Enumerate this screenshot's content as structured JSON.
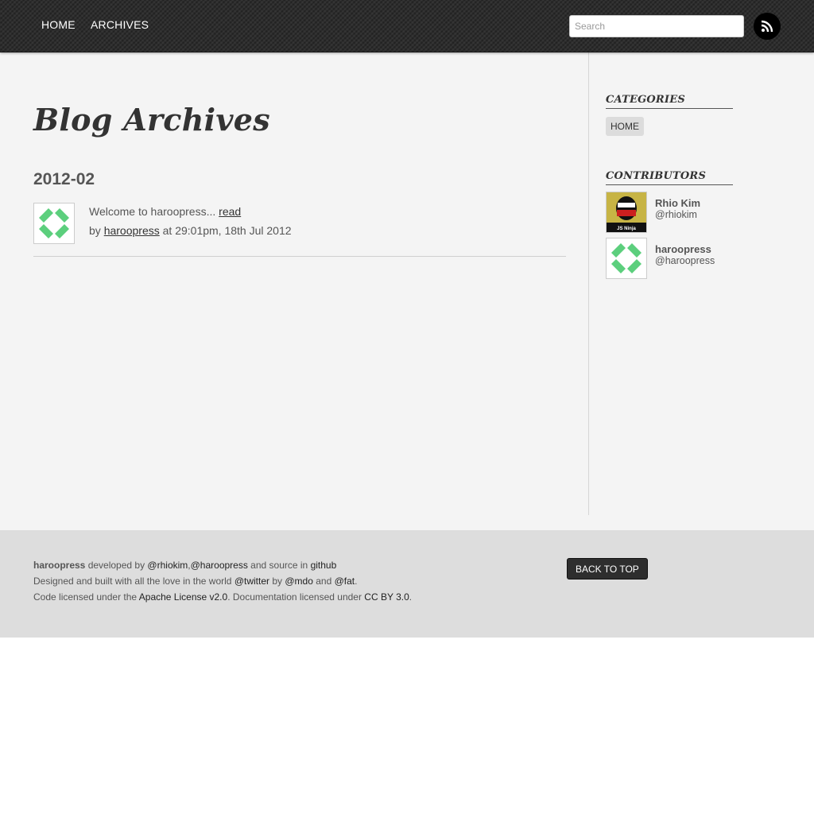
{
  "nav": {
    "home": "HOME",
    "archives": "ARCHIVES",
    "search_placeholder": "Search",
    "rss_icon": "rss-icon"
  },
  "main": {
    "title": "Blog Archives",
    "year": "2012-02",
    "post": {
      "excerpt": "Welcome to haroopress... ",
      "read_label": "read",
      "by_label": "by ",
      "author": "haroopress",
      "date": " at 29:01pm, 18th Jul 2012"
    }
  },
  "sidebar": {
    "categories_heading": "CATEGORIES",
    "categories": [
      "HOME"
    ],
    "contributors_heading": "CONTRIBUTORS",
    "contributors": [
      {
        "name": "Rhio Kim",
        "handle": "@rhiokim",
        "avatar_text": "JS Ninja"
      },
      {
        "name": "haroopress",
        "handle": "@haroopress"
      }
    ]
  },
  "footer": {
    "brand": "haroopress",
    "developed_by": " developed by ",
    "dev1": "@rhiokim",
    "comma": ",",
    "dev2": "@haroopress",
    "source_in": " and source in ",
    "github": "github",
    "designed": "Designed and built with all the love in the world ",
    "twitter": "@twitter",
    "by": " by ",
    "mdo": "@mdo",
    "and": " and ",
    "fat": "@fat",
    "period": ".",
    "code_licensed": "Code licensed under the ",
    "apache": "Apache License v2.0",
    "docs_licensed": ". Documentation licensed under ",
    "ccby": "CC BY 3.0",
    "period2": ".",
    "back_to_top": "BACK TO TOP"
  },
  "colors": {
    "header_bg": "#2e2e2e",
    "main_bg": "#f4f4f4",
    "footer_bg": "#dddddd",
    "identicon_green": "#5ccf7d"
  }
}
